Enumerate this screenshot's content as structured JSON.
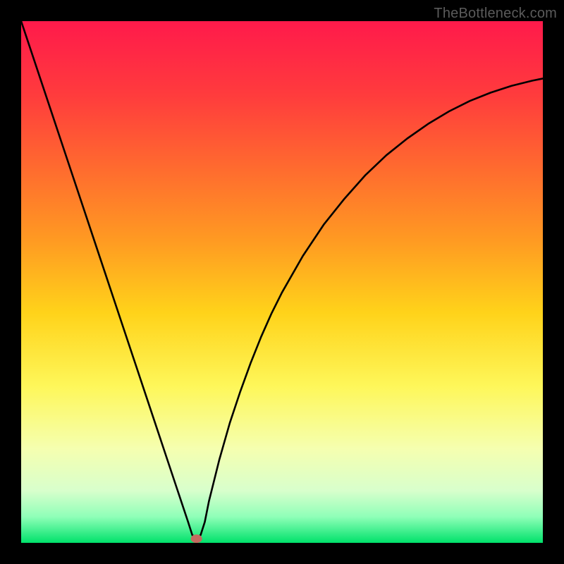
{
  "watermark": {
    "text": "TheBottleneck.com"
  },
  "chart_data": {
    "type": "line",
    "title": "",
    "xlabel": "",
    "ylabel": "",
    "xlim": [
      0,
      100
    ],
    "ylim": [
      0,
      100
    ],
    "grid": false,
    "background": {
      "type": "vertical-gradient",
      "stops": [
        {
          "pos": 0.0,
          "color": "#ff1a4b"
        },
        {
          "pos": 0.14,
          "color": "#ff3b3d"
        },
        {
          "pos": 0.28,
          "color": "#ff6a2f"
        },
        {
          "pos": 0.42,
          "color": "#ff9a22"
        },
        {
          "pos": 0.56,
          "color": "#ffd31a"
        },
        {
          "pos": 0.7,
          "color": "#fef75a"
        },
        {
          "pos": 0.82,
          "color": "#f5ffb0"
        },
        {
          "pos": 0.9,
          "color": "#d8ffcc"
        },
        {
          "pos": 0.95,
          "color": "#8fffb8"
        },
        {
          "pos": 1.0,
          "color": "#00e26b"
        }
      ]
    },
    "series": [
      {
        "name": "bottleneck-curve",
        "color": "#000000",
        "stroke_width": 2.6,
        "x": [
          0,
          2,
          4,
          6,
          8,
          10,
          12,
          14,
          16,
          18,
          20,
          22,
          24,
          26,
          28,
          30,
          31,
          32,
          32.8,
          33.6,
          34.4,
          35.2,
          36,
          38,
          40,
          42,
          44,
          46,
          48,
          50,
          54,
          58,
          62,
          66,
          70,
          74,
          78,
          82,
          86,
          90,
          94,
          98,
          100
        ],
        "y": [
          100,
          94,
          88,
          82,
          76,
          70,
          64,
          58,
          52,
          46,
          40,
          34,
          28,
          22,
          16,
          10,
          7,
          4,
          1.5,
          0.8,
          1.5,
          4,
          8,
          16,
          23,
          29,
          34.5,
          39.5,
          44,
          48,
          55,
          61,
          66,
          70.5,
          74.3,
          77.5,
          80.3,
          82.7,
          84.7,
          86.3,
          87.6,
          88.6,
          89
        ]
      }
    ],
    "marker": {
      "name": "optimum-point",
      "x": 33.6,
      "y": 0.8,
      "rx": 8,
      "ry": 6,
      "fill": "#c46a5f"
    }
  }
}
